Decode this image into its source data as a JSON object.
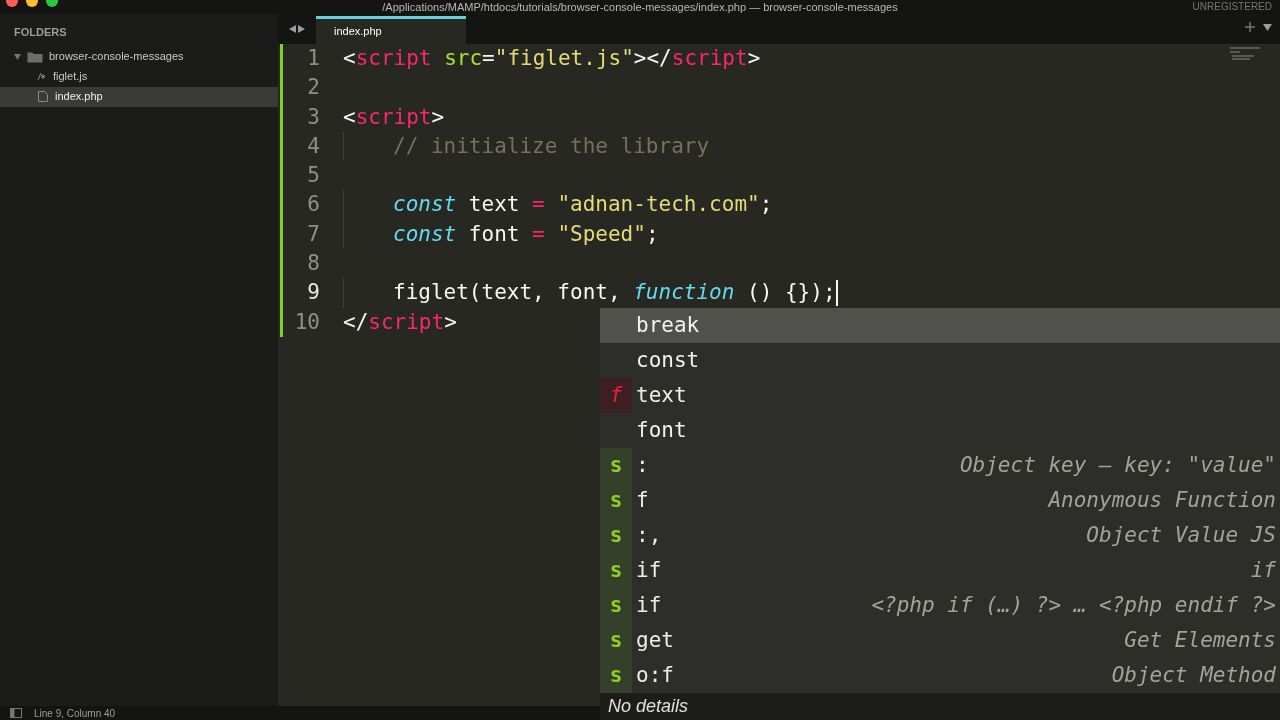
{
  "window": {
    "title": "/Applications/MAMP/htdocs/tutorials/browser-console-messages/index.php — browser-console-messages",
    "registration": "UNREGISTERED"
  },
  "sidebar": {
    "header": "FOLDERS",
    "folders": [
      {
        "name": "browser-console-messages",
        "expanded": true,
        "children": [
          {
            "name": "figlet.js",
            "kind": "script",
            "selected": false
          },
          {
            "name": "index.php",
            "kind": "file",
            "selected": true
          }
        ]
      }
    ]
  },
  "tabs": [
    {
      "label": "index.php",
      "selected": true
    }
  ],
  "editor": {
    "lines": [
      {
        "number": "1",
        "current": false,
        "modified": true,
        "indented": false,
        "tokens": [
          {
            "kind": "punct",
            "text": "<"
          },
          {
            "kind": "tag",
            "text": "script"
          },
          {
            "kind": "attr",
            "text": " src"
          },
          {
            "kind": "punct",
            "text": "="
          },
          {
            "kind": "string",
            "text": "\"figlet.js\""
          },
          {
            "kind": "punct",
            "text": "></"
          },
          {
            "kind": "tag",
            "text": "script"
          },
          {
            "kind": "punct",
            "text": ">"
          }
        ]
      },
      {
        "number": "2",
        "current": false,
        "modified": true,
        "indented": false
      },
      {
        "number": "3",
        "current": false,
        "modified": true,
        "indented": false,
        "tokens": [
          {
            "kind": "punct",
            "text": "<"
          },
          {
            "kind": "tag",
            "text": "script"
          },
          {
            "kind": "punct",
            "text": ">"
          }
        ]
      },
      {
        "number": "4",
        "current": false,
        "modified": true,
        "indented": true,
        "tokens": [
          {
            "kind": "comment",
            "text": "// initialize the library"
          }
        ]
      },
      {
        "number": "5",
        "current": false,
        "modified": true,
        "indented": false
      },
      {
        "number": "6",
        "current": false,
        "modified": true,
        "indented": true,
        "tokens": [
          {
            "kind": "keyword",
            "text": "const"
          },
          {
            "kind": "plain",
            "text": " text "
          },
          {
            "kind": "operator",
            "text": "="
          },
          {
            "kind": "string",
            "text": " \"adnan-tech.com\""
          },
          {
            "kind": "plain",
            "text": ";"
          }
        ]
      },
      {
        "number": "7",
        "current": false,
        "modified": true,
        "indented": true,
        "tokens": [
          {
            "kind": "keyword",
            "text": "const"
          },
          {
            "kind": "plain",
            "text": " font "
          },
          {
            "kind": "operator",
            "text": "="
          },
          {
            "kind": "string",
            "text": " \"Speed\""
          },
          {
            "kind": "plain",
            "text": ";"
          }
        ]
      },
      {
        "number": "8",
        "current": false,
        "modified": true,
        "indented": false
      },
      {
        "number": "9",
        "current": true,
        "modified": true,
        "indented": true,
        "tokens": [
          {
            "kind": "plain",
            "text": "figlet(text, font, "
          },
          {
            "kind": "keyword",
            "text": "function"
          },
          {
            "kind": "plain",
            "text": " () {});"
          }
        ]
      },
      {
        "number": "10",
        "current": false,
        "modified": true,
        "indented": false,
        "tokens": [
          {
            "kind": "punct",
            "text": "</"
          },
          {
            "kind": "tag",
            "text": "script"
          },
          {
            "kind": "punct",
            "text": ">"
          }
        ]
      }
    ]
  },
  "autocomplete": {
    "items": [
      {
        "kind": "word",
        "label": "break",
        "selected": true
      },
      {
        "kind": "word",
        "label": "const",
        "selected": false
      },
      {
        "kind": "function",
        "badge": "f",
        "label": "text",
        "selected": false
      },
      {
        "kind": "word",
        "label": "font",
        "selected": false
      },
      {
        "kind": "snippet",
        "badge": "s",
        "label": ":",
        "description": "Object key — key: \"value\"",
        "selected": false
      },
      {
        "kind": "snippet",
        "badge": "s",
        "label": "f",
        "description": "Anonymous Function",
        "selected": false
      },
      {
        "kind": "snippet",
        "badge": "s",
        "label": ":,",
        "description": "Object Value JS",
        "selected": false
      },
      {
        "kind": "snippet",
        "badge": "s",
        "label": "if",
        "description": "if",
        "selected": false
      },
      {
        "kind": "snippet",
        "badge": "s",
        "label": "if",
        "description": "<?php if (…) ?> … <?php endif ?>",
        "selected": false
      },
      {
        "kind": "snippet",
        "badge": "s",
        "label": "get",
        "description": "Get Elements",
        "selected": false
      },
      {
        "kind": "snippet",
        "badge": "s",
        "label": "o:f",
        "description": "Object Method",
        "selected": false
      }
    ],
    "footer": "No details"
  },
  "status_bar": {
    "position": "Line 9, Column 40"
  }
}
